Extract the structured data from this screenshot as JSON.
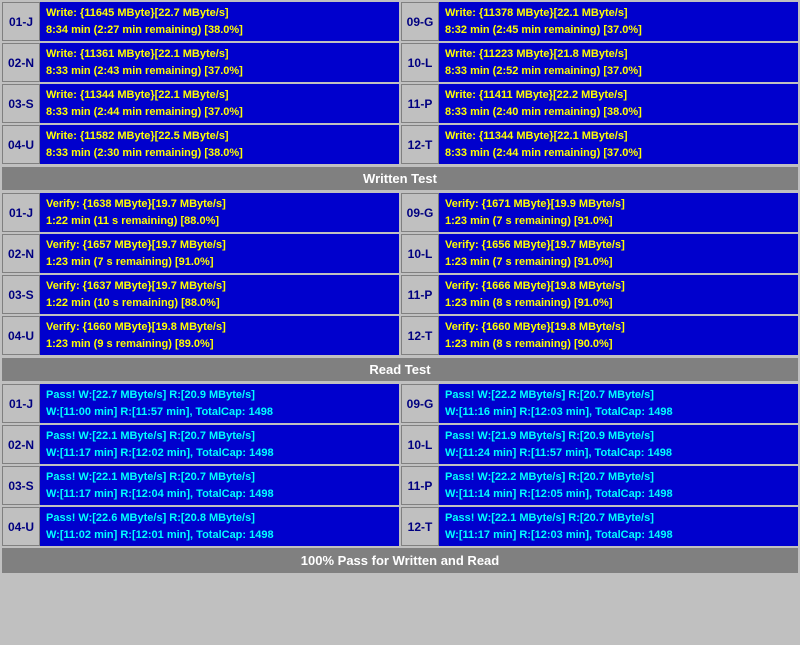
{
  "sections": {
    "write_test_label": "Written Test",
    "read_test_label": "Read Test",
    "footer_label": "100% Pass for Written and Read"
  },
  "write_rows": [
    {
      "left": {
        "label": "01-J",
        "line1": "Write: {11645 MByte}[22.7 MByte/s]",
        "line2": "8:34 min (2:27 min remaining)  [38.0%]"
      },
      "right": {
        "label": "09-G",
        "line1": "Write: {11378 MByte}[22.1 MByte/s]",
        "line2": "8:32 min (2:45 min remaining)  [37.0%]"
      }
    },
    {
      "left": {
        "label": "02-N",
        "line1": "Write: {11361 MByte}[22.1 MByte/s]",
        "line2": "8:33 min (2:43 min remaining)  [37.0%]"
      },
      "right": {
        "label": "10-L",
        "line1": "Write: {11223 MByte}[21.8 MByte/s]",
        "line2": "8:33 min (2:52 min remaining)  [37.0%]"
      }
    },
    {
      "left": {
        "label": "03-S",
        "line1": "Write: {11344 MByte}[22.1 MByte/s]",
        "line2": "8:33 min (2:44 min remaining)  [37.0%]"
      },
      "right": {
        "label": "11-P",
        "line1": "Write: {11411 MByte}[22.2 MByte/s]",
        "line2": "8:33 min (2:40 min remaining)  [38.0%]"
      }
    },
    {
      "left": {
        "label": "04-U",
        "line1": "Write: {11582 MByte}[22.5 MByte/s]",
        "line2": "8:33 min (2:30 min remaining)  [38.0%]"
      },
      "right": {
        "label": "12-T",
        "line1": "Write: {11344 MByte}[22.1 MByte/s]",
        "line2": "8:33 min (2:44 min remaining)  [37.0%]"
      }
    }
  ],
  "verify_rows": [
    {
      "left": {
        "label": "01-J",
        "line1": "Verify: {1638 MByte}[19.7 MByte/s]",
        "line2": "1:22 min (11 s remaining)   [88.0%]"
      },
      "right": {
        "label": "09-G",
        "line1": "Verify: {1671 MByte}[19.9 MByte/s]",
        "line2": "1:23 min (7 s remaining)   [91.0%]"
      }
    },
    {
      "left": {
        "label": "02-N",
        "line1": "Verify: {1657 MByte}[19.7 MByte/s]",
        "line2": "1:23 min (7 s remaining)   [91.0%]"
      },
      "right": {
        "label": "10-L",
        "line1": "Verify: {1656 MByte}[19.7 MByte/s]",
        "line2": "1:23 min (7 s remaining)   [91.0%]"
      }
    },
    {
      "left": {
        "label": "03-S",
        "line1": "Verify: {1637 MByte}[19.7 MByte/s]",
        "line2": "1:22 min (10 s remaining)   [88.0%]"
      },
      "right": {
        "label": "11-P",
        "line1": "Verify: {1666 MByte}[19.8 MByte/s]",
        "line2": "1:23 min (8 s remaining)   [91.0%]"
      }
    },
    {
      "left": {
        "label": "04-U",
        "line1": "Verify: {1660 MByte}[19.8 MByte/s]",
        "line2": "1:23 min (9 s remaining)   [89.0%]"
      },
      "right": {
        "label": "12-T",
        "line1": "Verify: {1660 MByte}[19.8 MByte/s]",
        "line2": "1:23 min (8 s remaining)   [90.0%]"
      }
    }
  ],
  "pass_rows": [
    {
      "left": {
        "label": "01-J",
        "line1": "Pass! W:[22.7 MByte/s] R:[20.9 MByte/s]",
        "line2": "W:[11:00 min] R:[11:57 min], TotalCap: 1498"
      },
      "right": {
        "label": "09-G",
        "line1": "Pass! W:[22.2 MByte/s] R:[20.7 MByte/s]",
        "line2": "W:[11:16 min] R:[12:03 min], TotalCap: 1498"
      }
    },
    {
      "left": {
        "label": "02-N",
        "line1": "Pass! W:[22.1 MByte/s] R:[20.7 MByte/s]",
        "line2": "W:[11:17 min] R:[12:02 min], TotalCap: 1498"
      },
      "right": {
        "label": "10-L",
        "line1": "Pass! W:[21.9 MByte/s] R:[20.9 MByte/s]",
        "line2": "W:[11:24 min] R:[11:57 min], TotalCap: 1498"
      }
    },
    {
      "left": {
        "label": "03-S",
        "line1": "Pass! W:[22.1 MByte/s] R:[20.7 MByte/s]",
        "line2": "W:[11:17 min] R:[12:04 min], TotalCap: 1498"
      },
      "right": {
        "label": "11-P",
        "line1": "Pass! W:[22.2 MByte/s] R:[20.7 MByte/s]",
        "line2": "W:[11:14 min] R:[12:05 min], TotalCap: 1498"
      }
    },
    {
      "left": {
        "label": "04-U",
        "line1": "Pass! W:[22.6 MByte/s] R:[20.8 MByte/s]",
        "line2": "W:[11:02 min] R:[12:01 min], TotalCap: 1498"
      },
      "right": {
        "label": "12-T",
        "line1": "Pass! W:[22.1 MByte/s] R:[20.7 MByte/s]",
        "line2": "W:[11:17 min] R:[12:03 min], TotalCap: 1498"
      }
    }
  ]
}
